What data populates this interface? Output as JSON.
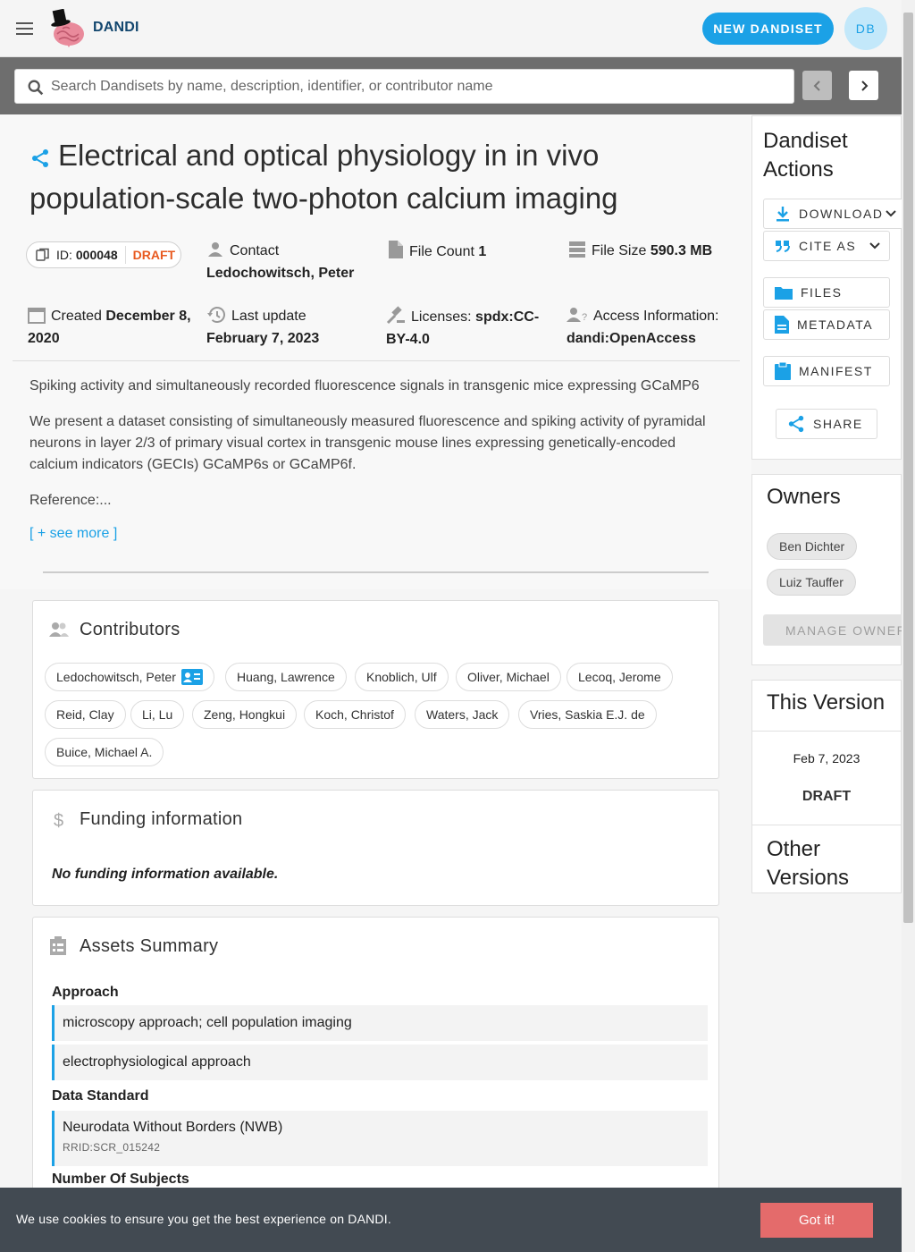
{
  "app": {
    "brand": "DANDI",
    "new_dandiset_label": "NEW DANDISET",
    "avatar_initials": "DB",
    "accent": "#1ba1e6"
  },
  "search": {
    "placeholder": "Search Dandisets by name, description, identifier, or contributor name"
  },
  "dandiset": {
    "title": "Electrical and optical physiology in in vivo population-scale two-photon calcium imaging",
    "id_label": "ID:",
    "id_value": "000048",
    "status": "DRAFT",
    "contact_label": "Contact",
    "contact_value": "Ledochowitsch, Peter",
    "file_count_label": "File Count",
    "file_count_value": "1",
    "file_size_label": "File Size",
    "file_size_value": "590.3 MB",
    "created_label": "Created",
    "created_value": "December 8, 2020",
    "updated_label": "Last update",
    "updated_value": "February 7, 2023",
    "license_label": "Licenses:",
    "license_value": "spdx:CC-BY-4.0",
    "access_label": "Access Information:",
    "access_value": "dandi:OpenAccess",
    "description": [
      "Spiking activity and simultaneously recorded fluorescence signals in transgenic mice expressing GCaMP6",
      "We present a dataset consisting of simultaneously measured fluorescence and spiking activity of pyramidal neurons in layer 2/3 of primary visual cortex in transgenic mouse lines expressing genetically-encoded calcium indicators (GECIs) GCaMP6s or GCaMP6f.",
      "Reference:..."
    ],
    "see_more": "[ + see more ]"
  },
  "contributors": {
    "title": "Contributors",
    "people": [
      "Ledochowitsch, Peter",
      "Huang, Lawrence",
      "Knoblich, Ulf",
      "Oliver, Michael",
      "Lecoq, Jerome",
      "Reid, Clay",
      "Li, Lu",
      "Zeng, Hongkui",
      "Koch, Christof",
      "Waters, Jack",
      "Vries, Saskia E.J. de",
      "Buice, Michael A."
    ]
  },
  "funding": {
    "title": "Funding information",
    "empty_text": "No funding information available."
  },
  "assets": {
    "title": "Assets Summary",
    "approach_label": "Approach",
    "approaches": [
      "microscopy approach; cell population imaging",
      "electrophysiological approach"
    ],
    "standard_label": "Data Standard",
    "standard_name": "Neurodata Without Borders (NWB)",
    "standard_rrid": "RRID:SCR_015242",
    "subjects_label": "Number Of Subjects"
  },
  "actions": {
    "title": "Dandiset Actions",
    "download": "DOWNLOAD",
    "cite": "CITE AS",
    "files": "FILES",
    "metadata": "METADATA",
    "manifest": "MANIFEST",
    "share": "SHARE"
  },
  "owners": {
    "title": "Owners",
    "people": [
      "Ben Dichter",
      "Luiz Tauffer"
    ],
    "manage_label": "MANAGE OWNERS"
  },
  "version": {
    "title": "This Version",
    "date": "Feb 7, 2023",
    "status": "DRAFT",
    "other_title": "Other Versions"
  },
  "cookie": {
    "text": "We use cookies to ensure you get the best experience on DANDI.",
    "button": "Got it!",
    "button_color": "#e46b6b"
  }
}
